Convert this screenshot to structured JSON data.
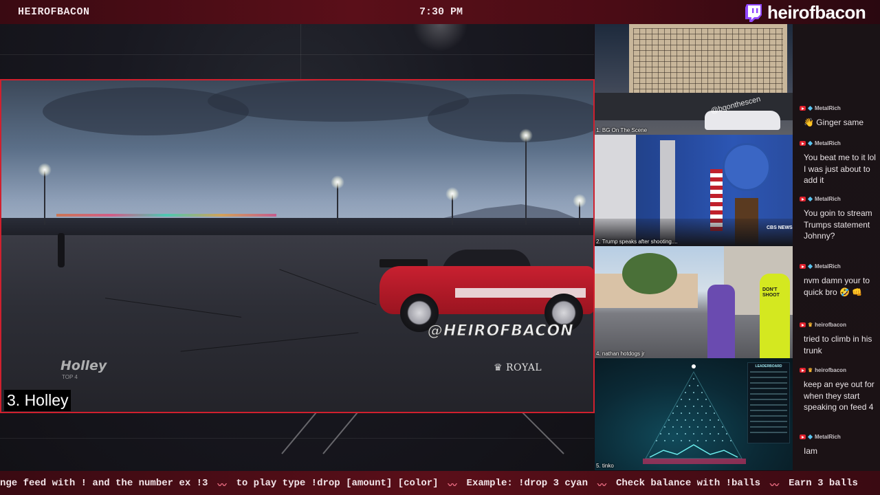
{
  "topbar": {
    "left_title": "HEIROFBACON",
    "clock": "7:30 PM",
    "brand": "heirofbacon"
  },
  "main_feed": {
    "watermark": "@HEIROFBACON",
    "logo_left": "Holley",
    "logo_left_sub": "TOP 4",
    "logo_right": "ROYAL",
    "caption": "3. Holley"
  },
  "side_feeds": [
    {
      "label": "1. BG On The Scene",
      "watermark": "@bgonthescen"
    },
    {
      "label": "2. Trump speaks after shooting....",
      "watermark": "CBS NEWS"
    },
    {
      "label": "4. nathan hotdogs jr",
      "watermark": "DON'T SHOOT"
    },
    {
      "label": "5. tinko",
      "watermark": "LEADERBOARD"
    }
  ],
  "chat": [
    {
      "user": "MetalRich",
      "badge": "gem",
      "text": "Ginger same",
      "emoji": "👋"
    },
    {
      "user": "MetalRich",
      "badge": "gem",
      "text": "You beat me to it lol I was just about to add it"
    },
    {
      "user": "MetalRich",
      "badge": "gem",
      "text": "You goin to stream Trumps statement Johnny?"
    },
    {
      "user": "MetalRich",
      "badge": "gem",
      "text": "nvm damn your to quick bro",
      "emoji": "🤣 👊"
    },
    {
      "user": "heirofbacon",
      "badge": "crown",
      "text": "tried to climb in his trunk"
    },
    {
      "user": "heirofbacon",
      "badge": "crown",
      "text": "keep an eye out for when they start speaking on feed 4"
    },
    {
      "user": "MetalRich",
      "badge": "gem",
      "text": "Iam"
    }
  ],
  "ticker": [
    "nge feed with ! and the number ex !3",
    "to play type !drop [amount] [color]",
    "Example: !drop 3 cyan",
    "Check balance with !balls",
    "Earn 3 balls"
  ],
  "colors": {
    "accent": "#d0202e",
    "bar": "#5a0f19",
    "twitch": "#9146ff"
  }
}
